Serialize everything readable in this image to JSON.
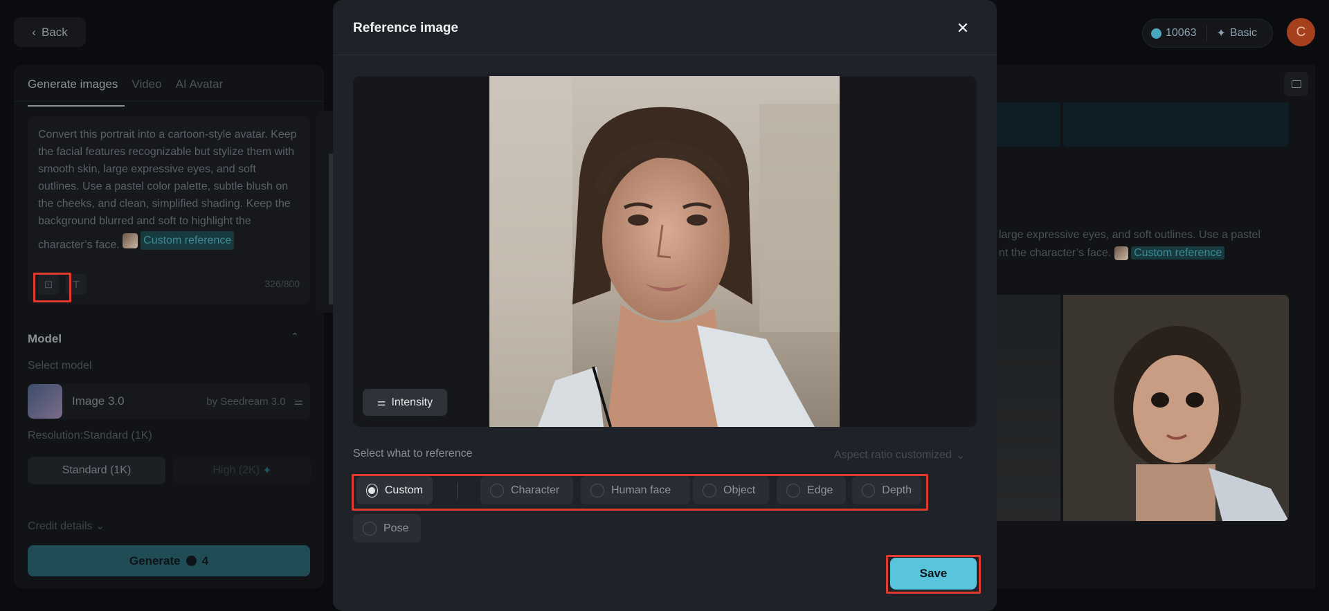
{
  "header": {
    "back_label": "Back",
    "credits": "10063",
    "plan": "Basic",
    "avatar_letter": "C"
  },
  "left_panel": {
    "tabs": [
      {
        "label": "Generate images"
      },
      {
        "label": "Video"
      },
      {
        "label": "AI Avatar"
      }
    ],
    "prompt": "Convert this portrait into a cartoon-style avatar. Keep the facial features recognizable but stylize them with smooth skin, large expressive eyes, and soft outlines. Use a pastel color palette, subtle blush on the cheeks, and clean, simplified shading. Keep the background blurred and soft to highlight the character’s face.",
    "reference_chip": "Custom reference",
    "char_count": "326/800",
    "model_section_title": "Model",
    "select_model_label": "Select model",
    "model_name": "Image 3.0",
    "model_by": "by Seedream 3.0",
    "resolution_label": "Resolution:Standard (1K)",
    "resolution_options": [
      "Standard (1K)",
      "High (2K)"
    ],
    "credit_details_label": "Credit details",
    "generate_label": "Generate",
    "generate_cost": "4"
  },
  "right_panel": {
    "text_line1": "large expressive eyes, and soft outlines. Use a pastel",
    "text_line2": "nt the character’s face.",
    "reference_chip": "Custom reference"
  },
  "modal": {
    "title": "Reference image",
    "intensity_label": "Intensity",
    "select_label": "Select what to reference",
    "aspect_label": "Aspect ratio customized",
    "options": [
      {
        "label": "Custom",
        "selected": true
      },
      {
        "label": "Character",
        "selected": false
      },
      {
        "label": "Human face",
        "selected": false
      },
      {
        "label": "Object",
        "selected": false
      },
      {
        "label": "Edge",
        "selected": false
      },
      {
        "label": "Depth",
        "selected": false
      },
      {
        "label": "Pose",
        "selected": false
      }
    ],
    "save_label": "Save"
  },
  "colors": {
    "accent": "#58c5dc",
    "highlight": "#e03a2f",
    "modal_bg": "#1f2228"
  }
}
